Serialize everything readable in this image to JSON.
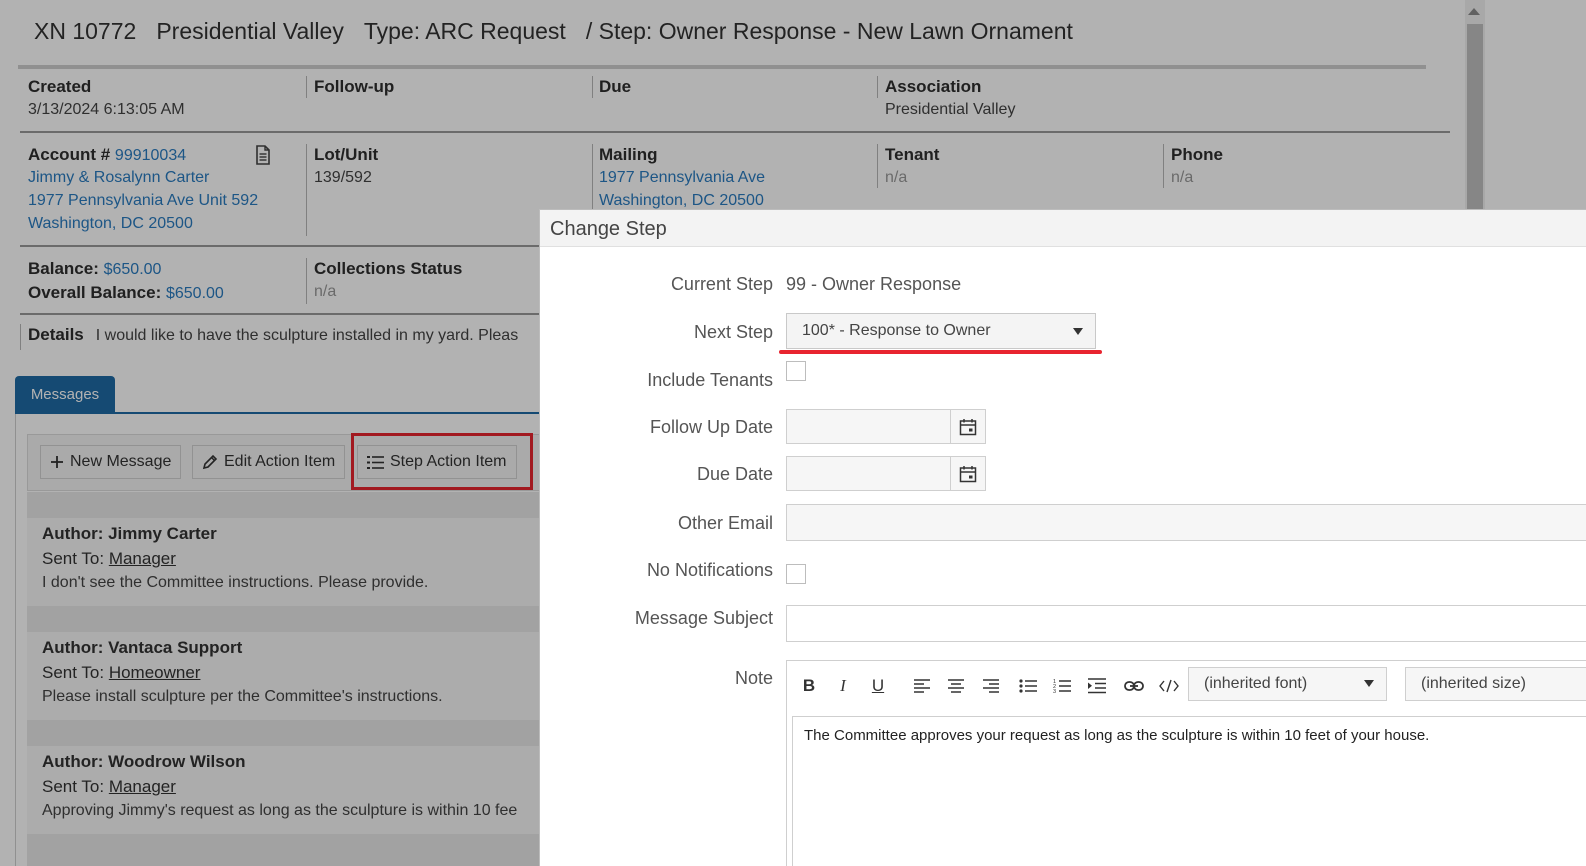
{
  "header": {
    "xn": "XN 10772",
    "association": "Presidential Valley",
    "type": "Type: ARC Request",
    "step": "/ Step: Owner Response - New Lawn Ornament"
  },
  "info": {
    "created_label": "Created",
    "created_value": "3/13/2024 6:13:05 AM",
    "followup_label": "Follow-up",
    "due_label": "Due",
    "association_label": "Association",
    "association_value": "Presidential Valley",
    "account_label": "Account #",
    "account_number": "99910034",
    "owner_name": "Jimmy & Rosalynn Carter",
    "owner_address1": "1977 Pennsylvania Ave Unit 592",
    "owner_address2": "Washington, DC 20500",
    "lot_label": "Lot/Unit",
    "lot_value": "139/592",
    "mailing_label": "Mailing",
    "mailing_address1": "1977 Pennsylvania Ave",
    "mailing_address2": "Washington, DC 20500",
    "tenant_label": "Tenant",
    "tenant_value": "n/a",
    "phone_label": "Phone",
    "phone_value": "n/a",
    "balance_label": "Balance:",
    "balance_value": "$650.00",
    "overall_balance_label": "Overall Balance:",
    "overall_balance_value": "$650.00",
    "collections_label": "Collections Status",
    "collections_value": "n/a",
    "details_label": "Details",
    "details_value": "I would like to have the sculpture installed in my yard. Pleas"
  },
  "tabs": {
    "messages": "Messages"
  },
  "toolbar": {
    "new_message": "New Message",
    "edit_action_item": "Edit Action Item",
    "step_action_item": "Step Action Item"
  },
  "messages": [
    {
      "author": "Author: Jimmy Carter",
      "sent_to_label": "Sent To:",
      "sent_to": "Manager",
      "body": "I don't see the Committee instructions. Please provide."
    },
    {
      "author": "Author: Vantaca Support",
      "sent_to_label": "Sent To:",
      "sent_to": "Homeowner",
      "body": "Please install sculpture per the Committee's instructions."
    },
    {
      "author": "Author: Woodrow Wilson",
      "sent_to_label": "Sent To:",
      "sent_to": "Manager",
      "body": "Approving Jimmy's request as long as the sculpture is within 10 fee"
    }
  ],
  "modal": {
    "title": "Change Step",
    "current_step_label": "Current Step",
    "current_step_value": "99 - Owner Response",
    "next_step_label": "Next Step",
    "next_step_value": "100* - Response to Owner",
    "include_tenants_label": "Include Tenants",
    "follow_up_date_label": "Follow Up Date",
    "due_date_label": "Due Date",
    "other_email_label": "Other Email",
    "no_notifications_label": "No Notifications",
    "message_subject_label": "Message Subject",
    "note_label": "Note",
    "font_dropdown": "(inherited font)",
    "size_dropdown": "(inherited size)",
    "note_text": "The Committee approves your request as long as the sculpture is within 10 feet of your house."
  },
  "colors": {
    "accent": "#1f6aa5",
    "link": "#2a7cc0",
    "highlight": "#e8242f"
  }
}
